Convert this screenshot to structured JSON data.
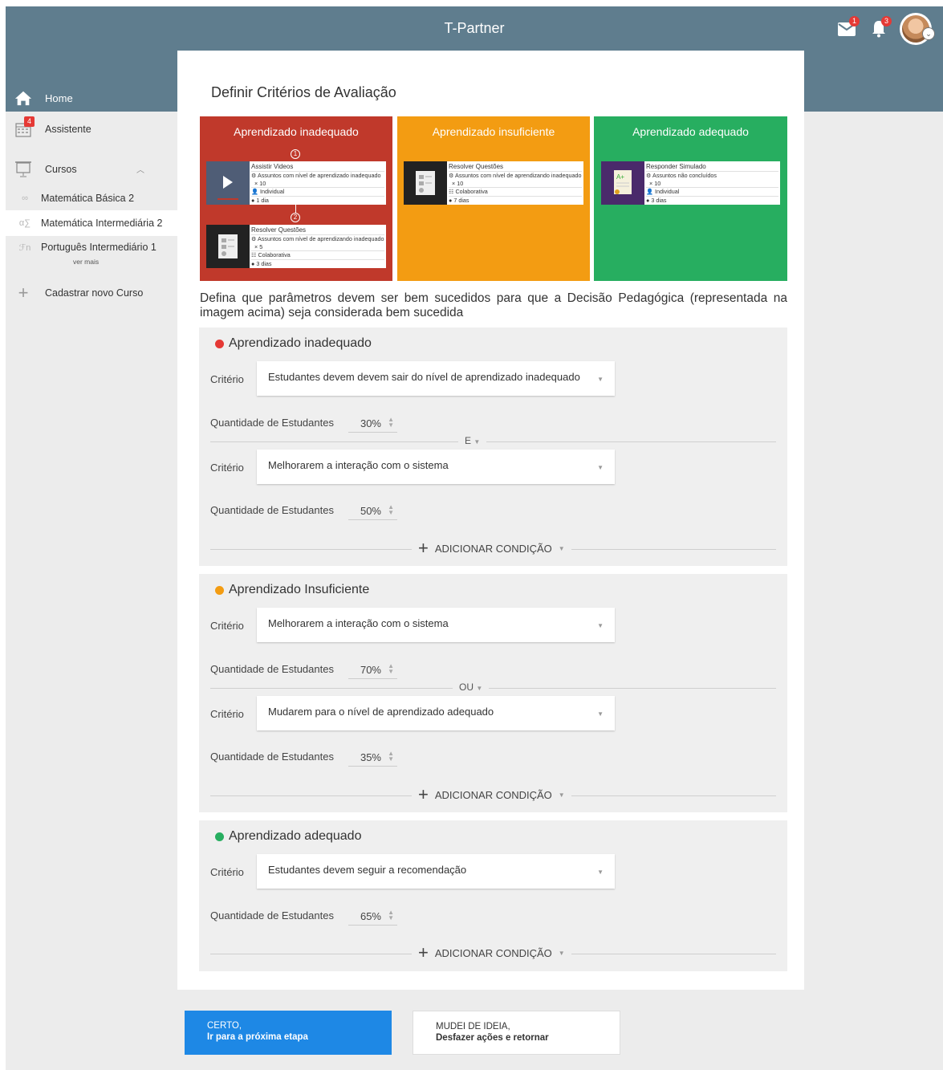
{
  "app": {
    "title": "T-Partner",
    "mail_count": "1",
    "notif_count": "3"
  },
  "sidebar": {
    "home": "Home",
    "assistant": "Assistente",
    "assistant_badge": "4",
    "courses": "Cursos",
    "course_items": [
      {
        "label": "Matemática Básica 2",
        "icon": "∞"
      },
      {
        "label": "Matemática Intermediária 2",
        "icon": "α∑"
      },
      {
        "label": "Português Intermediário 1",
        "icon": "ℱn"
      }
    ],
    "more": "ver mais",
    "new_course": "Cadastrar novo Curso"
  },
  "main": {
    "title": "Definir Critérios de Avaliação",
    "levels": [
      {
        "name": "Aprendizado inadequado",
        "color": "#c0392b",
        "steps": [
          "1",
          "2"
        ],
        "activities": [
          {
            "title": "Assistir Videos",
            "topic": "Assuntos com nível de aprendizado inadequado",
            "count": "× 10",
            "mode": "Individual",
            "duration": "1 dia"
          },
          {
            "title": "Resolver Questões",
            "topic": "Assuntos com nível de aprendizando inadequado",
            "count": "× 5",
            "mode": "Colaborativa",
            "duration": "3 dias"
          }
        ]
      },
      {
        "name": "Aprendizado insuficiente",
        "color": "#f39c12",
        "activities": [
          {
            "title": "Resolver Questões",
            "topic": "Assuntos com nível de aprendizando inadequado",
            "count": "× 10",
            "mode": "Colaborativa",
            "duration": "7 dias"
          }
        ]
      },
      {
        "name": "Aprendizado adequado",
        "color": "#27ae60",
        "activities": [
          {
            "title": "Responder Simulado",
            "topic": "Assuntos não concluídos",
            "count": "× 10",
            "mode": "Individual",
            "duration": "3 dias"
          }
        ]
      }
    ],
    "instructions": "Defina que parâmetros devem ser bem sucedidos para que a Decisão Pedagógica (representada na imagem acima) seja considerada bem sucedida",
    "criterion_label": "Critério",
    "quantity_label": "Quantidade de Estudantes",
    "add_condition": "ADICIONAR CONDIÇÃO",
    "sections": [
      {
        "title": "Aprendizado inadequado",
        "dot_color": "#e53935",
        "c1": "Estudantes devem devem sair do nível de aprendizado inadequado",
        "q1": "30%",
        "join": "E",
        "c2": "Melhorarem a interação com o sistema",
        "q2": "50%"
      },
      {
        "title": "Aprendizado Insuficiente",
        "dot_color": "#f39c12",
        "c1": "Melhorarem a interação com o sistema",
        "q1": "70%",
        "join": "OU",
        "c2": "Mudarem para o nível de aprendizado adequado",
        "q2": "35%"
      },
      {
        "title": "Aprendizado adequado",
        "dot_color": "#27ae60",
        "c1": "Estudantes devem seguir a recomendação",
        "q1": "65%"
      }
    ]
  },
  "actions": {
    "primary_line1": "CERTO,",
    "primary_line2": "Ir para a próxima etapa",
    "secondary_line1": "MUDEI DE IDEIA,",
    "secondary_line2": "Desfazer ações e retornar"
  }
}
